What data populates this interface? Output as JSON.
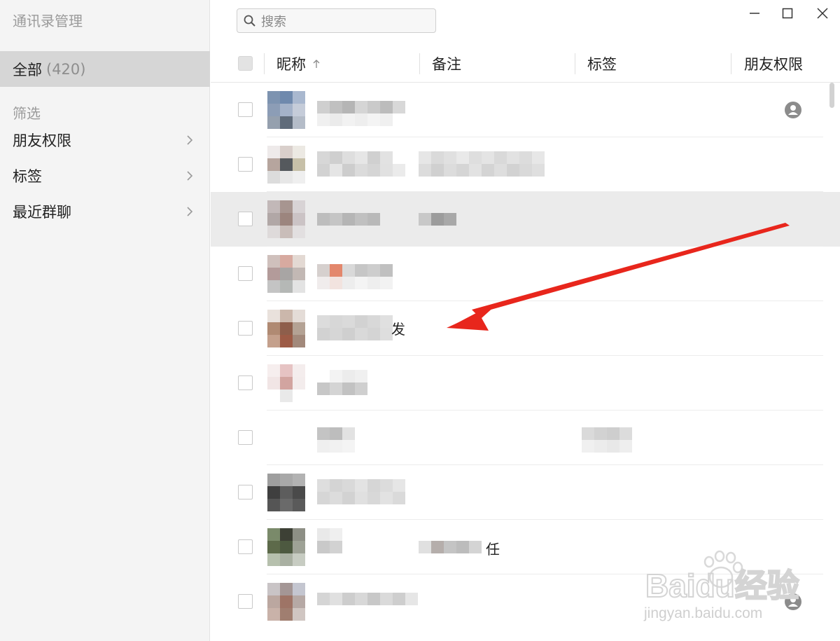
{
  "window": {
    "title": "通讯录管理",
    "controls": [
      "minimize",
      "maximize",
      "close"
    ]
  },
  "sidebar": {
    "all": {
      "label": "全部",
      "count": "(420)"
    },
    "filter_heading": "筛选",
    "filters": [
      {
        "label": "朋友权限"
      },
      {
        "label": "标签"
      },
      {
        "label": "最近群聊"
      }
    ]
  },
  "search": {
    "placeholder": "搜索"
  },
  "table": {
    "columns": [
      "昵称",
      "备注",
      "标签",
      "朋友权限"
    ],
    "sort_column": "昵称",
    "sort_direction": "ascending",
    "rows": [
      {
        "nickname": "",
        "remark": "",
        "tag": "",
        "permission_icon": "profile-icon"
      },
      {
        "nickname": "",
        "remark": "",
        "tag": "",
        "permission_icon": ""
      },
      {
        "nickname": "",
        "remark": "",
        "tag": "",
        "permission_icon": "",
        "selected": true
      },
      {
        "nickname": "",
        "remark": "",
        "tag": "",
        "permission_icon": ""
      },
      {
        "nickname": "发",
        "remark": "",
        "tag": "",
        "permission_icon": ""
      },
      {
        "nickname": "",
        "remark": "",
        "tag": "",
        "permission_icon": ""
      },
      {
        "nickname": "",
        "remark": "",
        "tag": "",
        "permission_icon": ""
      },
      {
        "nickname": "",
        "remark": "",
        "tag": "",
        "permission_icon": ""
      },
      {
        "nickname": "",
        "remark": "任",
        "tag": "",
        "permission_icon": ""
      },
      {
        "nickname": "",
        "remark": "",
        "tag": "",
        "permission_icon": "profile-icon"
      }
    ]
  },
  "annotation": {
    "arrow_color": "#e8261c"
  },
  "watermark": {
    "brand": "Baidu经验",
    "url": "jingyan.baidu.com"
  },
  "colors": {
    "sidebar_bg": "#f4f4f4",
    "sidebar_selected": "#d6d6d6",
    "row_selected": "#ebebeb"
  }
}
